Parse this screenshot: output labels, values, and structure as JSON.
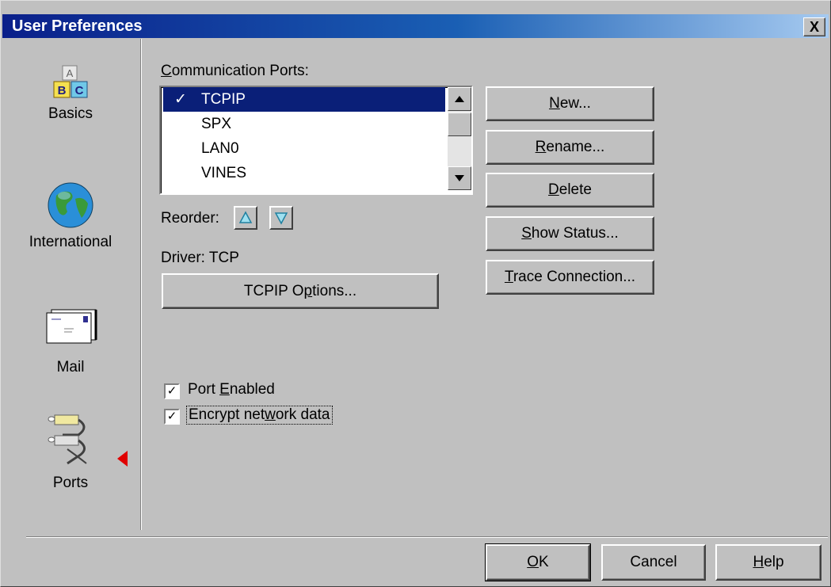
{
  "window": {
    "title": "User Preferences",
    "close_label": "X"
  },
  "sidebar": {
    "items": [
      {
        "label": "Basics",
        "icon": "abc-blocks-icon"
      },
      {
        "label": "International",
        "icon": "globe-icon"
      },
      {
        "label": "Mail",
        "icon": "envelopes-icon"
      },
      {
        "label": "Ports",
        "icon": "ports-icon"
      }
    ],
    "selected": "Ports"
  },
  "ports": {
    "list_label": "Communication Ports:",
    "list_label_accel": "C",
    "list_label_rest": "ommunication Ports:",
    "items": [
      {
        "name": "TCPIP",
        "checked": true,
        "selected": true
      },
      {
        "name": "SPX",
        "checked": false,
        "selected": false
      },
      {
        "name": "LAN0",
        "checked": false,
        "selected": false
      },
      {
        "name": "VINES",
        "checked": false,
        "selected": false
      }
    ],
    "check_mark": "✓",
    "reorder_label": "Reorder:",
    "driver_label": "Driver:  TCP",
    "options_button": {
      "pre": "TCPIP O",
      "accel": "p",
      "post": "tions..."
    },
    "port_enabled": {
      "pre": "Port ",
      "accel": "E",
      "post": "nabled",
      "checked": true
    },
    "encrypt": {
      "pre": "Encrypt net",
      "accel": "w",
      "post": "ork data",
      "checked": true
    }
  },
  "buttons": {
    "new": {
      "accel": "N",
      "rest": "ew..."
    },
    "rename": {
      "accel": "R",
      "rest": "ename..."
    },
    "delete": {
      "accel": "D",
      "rest": "elete"
    },
    "show_status": {
      "accel": "S",
      "rest": "how Status..."
    },
    "trace": {
      "accel": "T",
      "rest": "race Connection..."
    }
  },
  "footer": {
    "ok": {
      "accel": "O",
      "rest": "K"
    },
    "cancel": "Cancel",
    "help": {
      "accel": "H",
      "rest": "elp"
    }
  },
  "colors": {
    "title_start": "#0a1f8a",
    "title_end": "#a6caf0",
    "selection": "#0a1f78",
    "face": "#c0c0c0",
    "pointer": "#e00000"
  }
}
